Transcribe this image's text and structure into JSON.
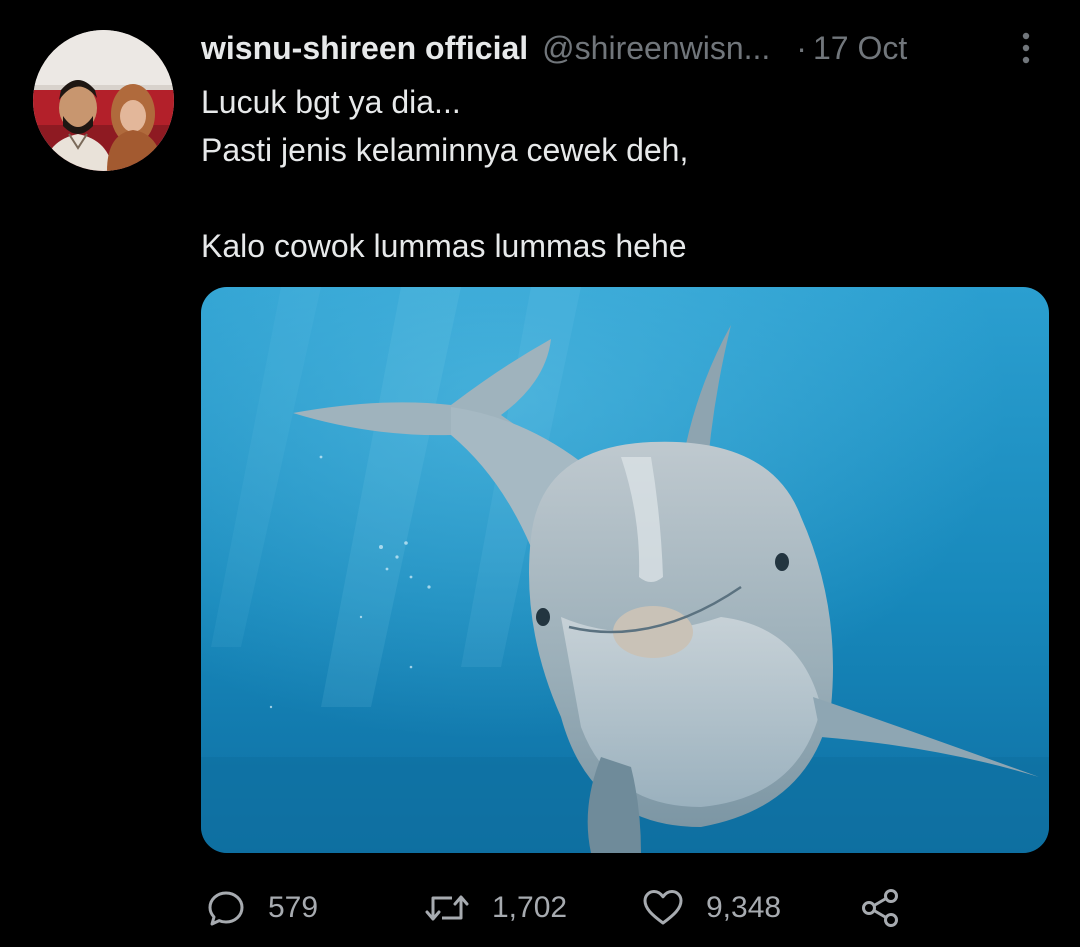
{
  "tweet": {
    "author": {
      "display_name": "wisnu-shireen official",
      "handle": "@shireenwisn..."
    },
    "separator": "·",
    "date": "17 Oct",
    "text_lines": [
      "Lucuk bgt ya dia...",
      "Pasti jenis kelaminnya cewek deh,",
      "",
      "Kalo cowok lummas lummas hehe"
    ]
  },
  "actions": {
    "reply": {
      "icon": "reply-icon",
      "count": "579"
    },
    "retweet": {
      "icon": "retweet-icon",
      "count": "1,702"
    },
    "like": {
      "icon": "heart-icon",
      "count": "9,348"
    },
    "share": {
      "icon": "share-icon"
    }
  },
  "colors": {
    "background": "#000000",
    "primary_text": "#e7e9ea",
    "secondary_text": "#71767b",
    "media_water": "#1a8fc0"
  }
}
